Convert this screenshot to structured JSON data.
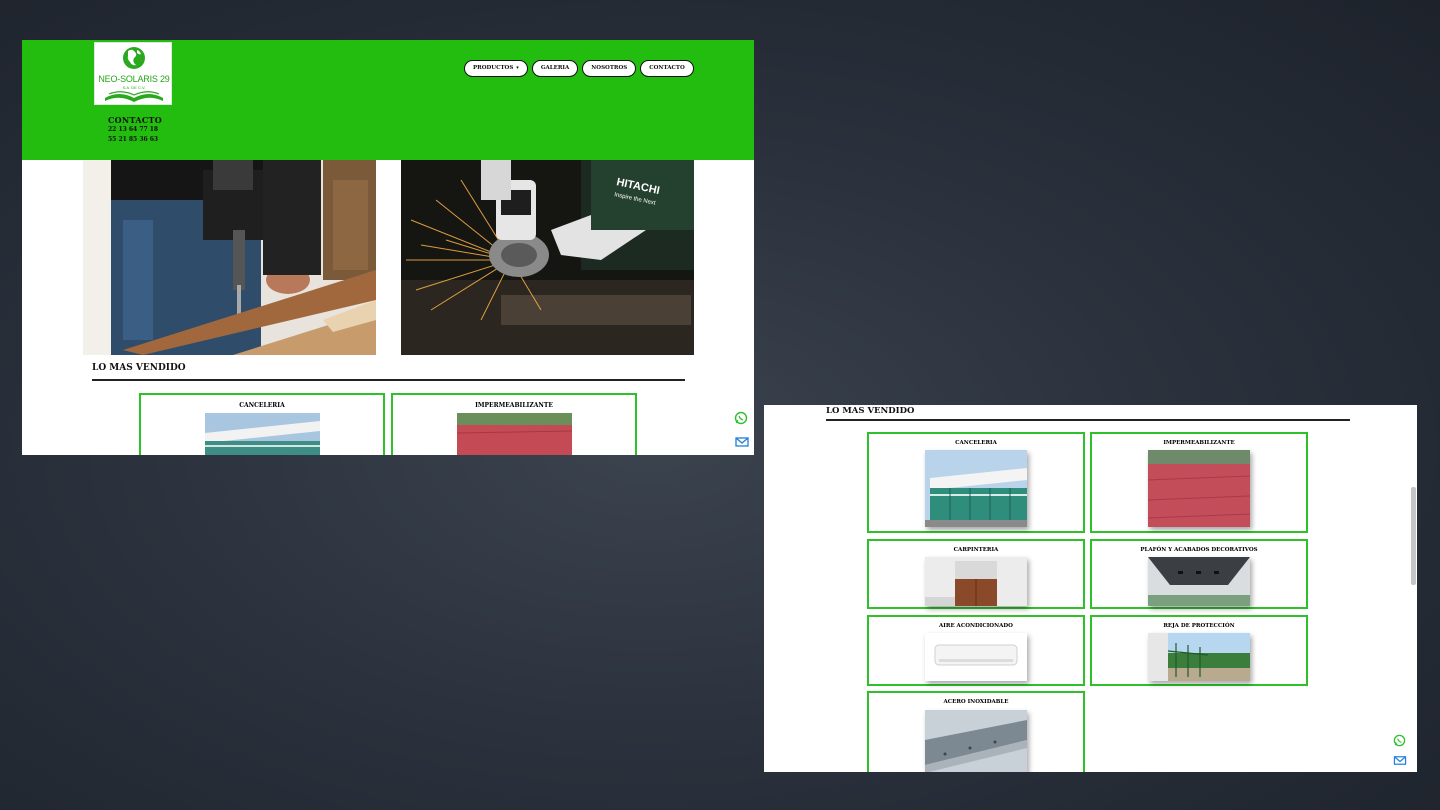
{
  "colors": {
    "brand_green": "#23bd10",
    "card_border": "#2ec12a",
    "backdrop": "#2b323d"
  },
  "logo": {
    "name": "NEO-SOLARIS 29",
    "subtitle": "S.A. DE C.V."
  },
  "contact": {
    "title": "CONTACTO",
    "phones": [
      "22 13 64 77 18",
      "55 21 85 36 63"
    ]
  },
  "nav": {
    "items": [
      {
        "label": "PRODUCTOS",
        "has_caret": true
      },
      {
        "label": "GALERIA"
      },
      {
        "label": "NOSOTROS"
      },
      {
        "label": "CONTACTO"
      }
    ],
    "caret": "▾"
  },
  "section": {
    "best_sellers": "LO MAS VENDIDO"
  },
  "products": [
    {
      "label": "CANCELERIA",
      "icon": "glass-building-photo"
    },
    {
      "label": "IMPERMEABILIZANTE",
      "icon": "red-roof-photo"
    },
    {
      "label": "CARPINTERIA",
      "icon": "wood-cabinet-photo"
    },
    {
      "label": "PLAFÓN Y ACABADOS DECORATIVOS",
      "icon": "ceiling-photo"
    },
    {
      "label": "AIRE ACONDICIONADO",
      "icon": "air-conditioner-photo"
    },
    {
      "label": "REJA DE PROTECCIÓN",
      "icon": "green-fence-photo"
    },
    {
      "label": "ACERO INOXIDABLE",
      "icon": "steel-sheet-photo"
    }
  ],
  "hero_images": [
    {
      "icon": "drilling-wood-photo"
    },
    {
      "icon": "angle-grinder-sparks-photo",
      "brand_text": "HITACHI",
      "brand_tagline": "Inspire the Next"
    }
  ],
  "floating": {
    "whatsapp_icon": "whatsapp-icon",
    "email_icon": "envelope-icon"
  }
}
